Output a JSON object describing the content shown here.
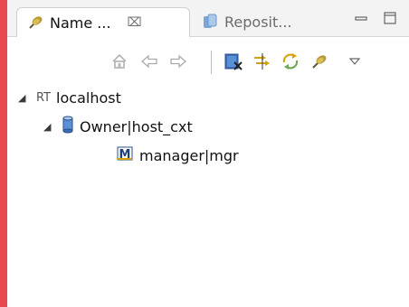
{
  "tabs": [
    {
      "label": "Name ...",
      "close_glyph": "⌧",
      "icon": "plug-icon",
      "active": true
    },
    {
      "label": "Reposit...",
      "icon": "repository-icon",
      "active": false
    }
  ],
  "window_controls": [
    {
      "name": "minimize-icon"
    },
    {
      "name": "maximize-icon"
    }
  ],
  "toolbar": {
    "items": [
      {
        "name": "home-icon"
      },
      {
        "name": "back-arrow-icon"
      },
      {
        "name": "forward-arrow-icon"
      },
      {
        "name": "remove-connection-icon"
      },
      {
        "name": "filter-icon"
      },
      {
        "name": "refresh-icon"
      },
      {
        "name": "connect-icon"
      },
      {
        "name": "view-menu-icon"
      }
    ]
  },
  "tree": {
    "root": {
      "label": "localhost",
      "prefix": "RT",
      "expanded": true
    },
    "child": {
      "label": "Owner|host_cxt",
      "icon": "database-icon",
      "expanded": true
    },
    "leaf": {
      "label": "manager|mgr",
      "icon": "mgr-icon"
    }
  },
  "colors": {
    "accent": "#e8484f",
    "tab_bar": "#f3f3f3"
  }
}
